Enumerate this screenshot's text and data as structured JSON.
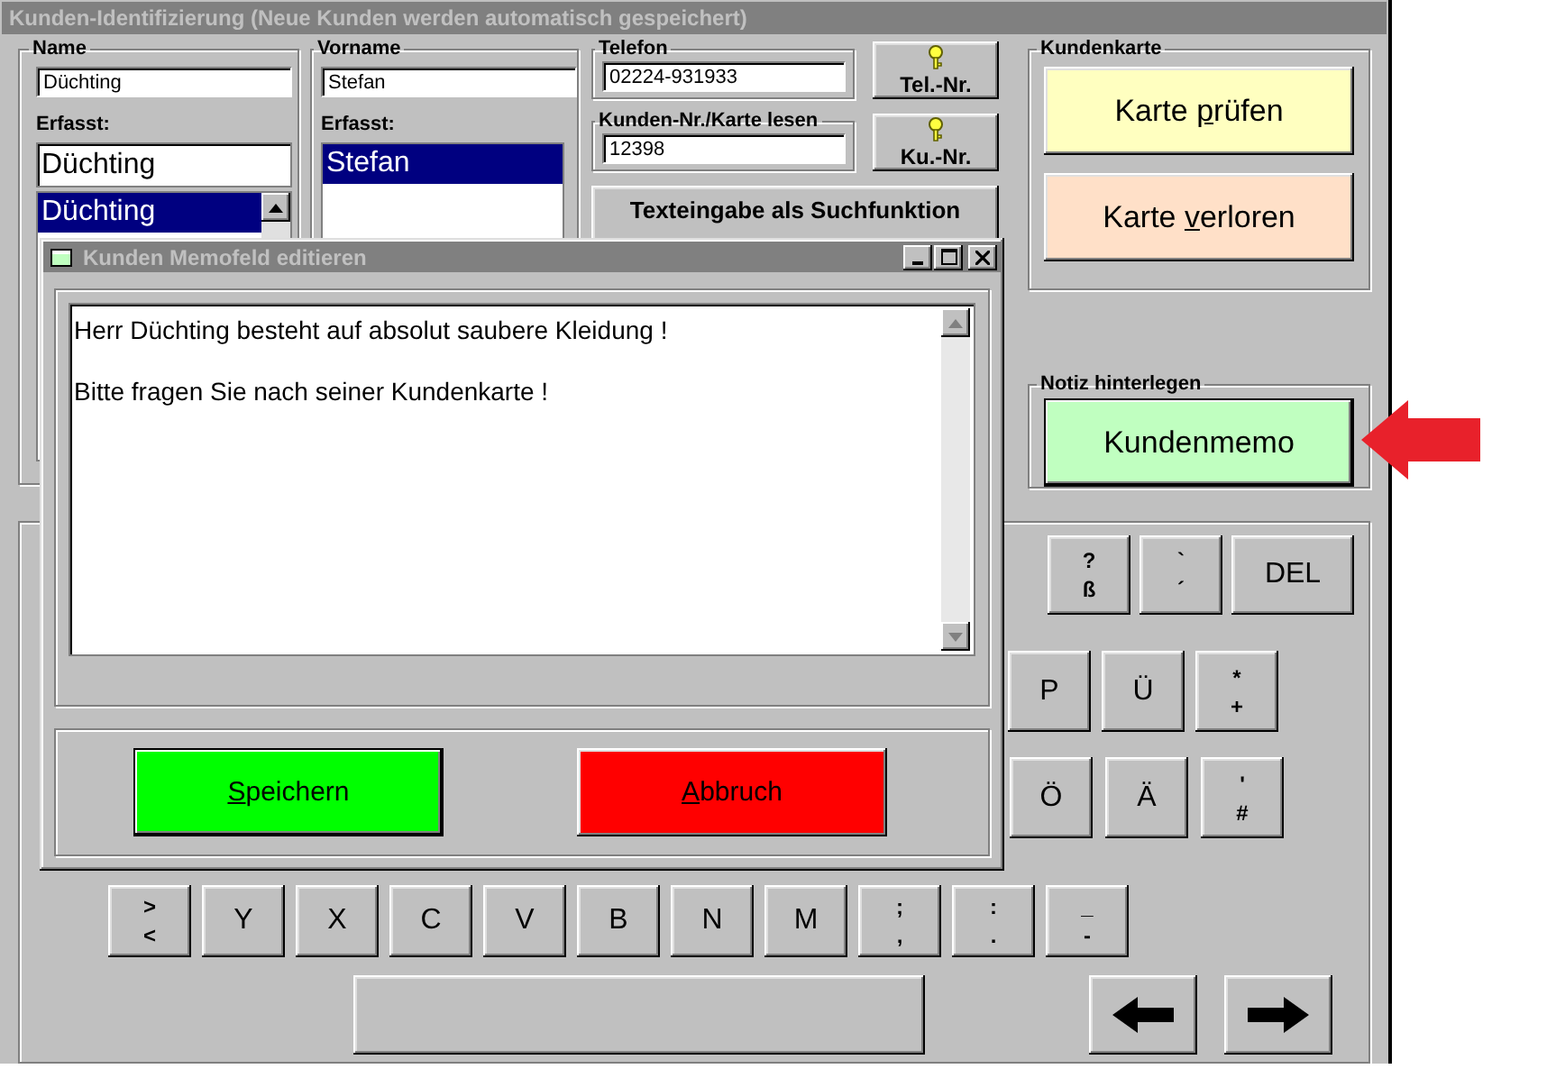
{
  "window": {
    "title": "Kunden-Identifizierung (Neue Kunden werden automatisch gespeichert)"
  },
  "name_group": {
    "label": "Name",
    "value": "Düchting",
    "captured_label": "Erfasst:",
    "captured_value": "Düchting",
    "list": [
      {
        "text": "Düchting",
        "selected": true
      }
    ]
  },
  "firstname_group": {
    "label": "Vorname",
    "value": "Stefan",
    "captured_label": "Erfasst:",
    "list": [
      {
        "text": "Stefan",
        "selected": true
      }
    ]
  },
  "phone_group": {
    "label": "Telefon",
    "value": "02224-931933"
  },
  "phone_lookup_button": {
    "label": "Tel.-Nr."
  },
  "customer_number_group": {
    "label": "Kunden-Nr./Karte lesen",
    "value": "12398"
  },
  "customer_lookup_button": {
    "label": "Ku.-Nr."
  },
  "text_search_button": {
    "label": "Texteingabe als Suchfunktion"
  },
  "card_group": {
    "label": "Kundenkarte",
    "buttons": [
      {
        "before": "Karte ",
        "accel": "p",
        "after": "rüfen",
        "color": "#ffffc0",
        "focused": false
      },
      {
        "before": "Karte ",
        "accel": "v",
        "after": "erloren",
        "color": "#ffe0c8",
        "focused": false
      }
    ]
  },
  "note_group": {
    "label": "Notiz hinterlegen",
    "buttons": [
      {
        "before": "Kundenmemo",
        "color": "#c0ffc0",
        "focused": true
      }
    ]
  },
  "keyboard": {
    "rows": [
      {
        "keys": [
          {
            "kind": "double",
            "top": "?",
            "bottom": "ß"
          },
          {
            "kind": "double",
            "top": "`",
            "bottom": "´"
          },
          {
            "kind": "wide",
            "label": "DEL"
          }
        ]
      },
      {
        "keys": [
          {
            "kind": "single",
            "label": "P"
          },
          {
            "kind": "single",
            "label": "Ü"
          },
          {
            "kind": "double",
            "top": "*",
            "bottom": "+"
          }
        ]
      },
      {
        "keys": [
          {
            "kind": "single",
            "label": "Ö"
          },
          {
            "kind": "single",
            "label": "Ä"
          },
          {
            "kind": "double",
            "top": "'",
            "bottom": "#"
          }
        ]
      },
      {
        "keys": [
          {
            "kind": "double",
            "top": ">",
            "bottom": "<"
          },
          {
            "kind": "single",
            "label": "Y"
          },
          {
            "kind": "single",
            "label": "X"
          },
          {
            "kind": "single",
            "label": "C"
          },
          {
            "kind": "single",
            "label": "V"
          },
          {
            "kind": "single",
            "label": "B"
          },
          {
            "kind": "single",
            "label": "N"
          },
          {
            "kind": "single",
            "label": "M"
          },
          {
            "kind": "double",
            "top": ";",
            "bottom": ","
          },
          {
            "kind": "double",
            "top": ":",
            "bottom": "."
          },
          {
            "kind": "double",
            "top": "_",
            "bottom": "-"
          }
        ]
      },
      {
        "keys": [
          {
            "kind": "space"
          },
          {
            "kind": "arrow-left"
          },
          {
            "kind": "arrow-right"
          }
        ]
      }
    ]
  },
  "dialog": {
    "title": "Kunden Memofeld editieren",
    "memo_lines": [
      "Herr Düchting besteht auf absolut saubere Kleidung !",
      "Bitte fragen Sie nach seiner Kundenkarte !"
    ],
    "buttons": [
      {
        "accel": "S",
        "after": "peichern",
        "color": "#00ff00",
        "focused": true
      },
      {
        "accel": "A",
        "after": "bbruch",
        "color": "#ff0000",
        "focused": false
      }
    ]
  }
}
